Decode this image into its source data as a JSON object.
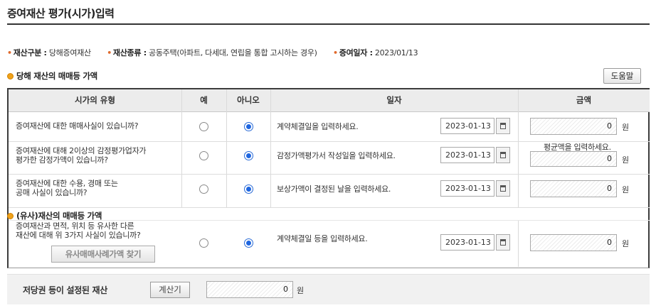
{
  "page_title": "증여재산 평가(시가)입력",
  "info": {
    "category_label": "재산구분 :",
    "category_value": "당해증여재산",
    "type_label": "재산종류 :",
    "type_value": "공동주택(아파트, 다세대, 연립을 통합 고시하는 경우)",
    "date_label": "증여일자 :",
    "date_value": "2023/01/13"
  },
  "section1_title": "당해 재산의 매매등 가액",
  "help_button": "도움말",
  "columns": {
    "type": "시가의 유형",
    "yes": "예",
    "no": "아니오",
    "date": "일자",
    "amount": "금액"
  },
  "rows": [
    {
      "question_lines": [
        "증여재산에 대한 매매사실이 있습니까?"
      ],
      "selected": "no",
      "date_label": "계약체결일을 입력하세요.",
      "date": "2023-01-13",
      "amount": "0",
      "unit": "원"
    },
    {
      "question_lines": [
        "증여재산에 대해 2이상의 감정평가업자가",
        "평가한 감정가액이 있습니까?"
      ],
      "selected": "no",
      "date_label": "감정가액평가서 작성일을 입력하세요.",
      "date": "2023-01-13",
      "amount_note": "평균액을 입력하세요.",
      "amount": "0",
      "unit": "원"
    },
    {
      "question_lines": [
        "증여재산에 대한 수용, 경매 또는",
        "공매 사실이 있습니까?"
      ],
      "selected": "no",
      "date_label": "보상가액이 결정된 날을 입력하세요.",
      "date": "2023-01-13",
      "amount": "0",
      "unit": "원"
    }
  ],
  "section2_title": "(유사)재산의 매매등 가액",
  "similar_row": {
    "question_lines": [
      "증여재산과 면적, 위치 등 유사한 다른",
      "재산에 대해 위 3가지 사실이 있습니까?"
    ],
    "find_button": "유사매매사례가액 찾기",
    "selected": "no",
    "date_label": "계약체결일 등을 입력하세요.",
    "date": "2023-01-13",
    "amount": "0",
    "unit": "원"
  },
  "bottom": {
    "label": "저당권 등이 설정된 재산",
    "calc_button": "계산기",
    "amount": "0",
    "unit": "원"
  },
  "colors": {
    "accent_dot": "#e06a2c",
    "section_icon": "#f0a21a",
    "radio_selected": "#1e66e0"
  }
}
